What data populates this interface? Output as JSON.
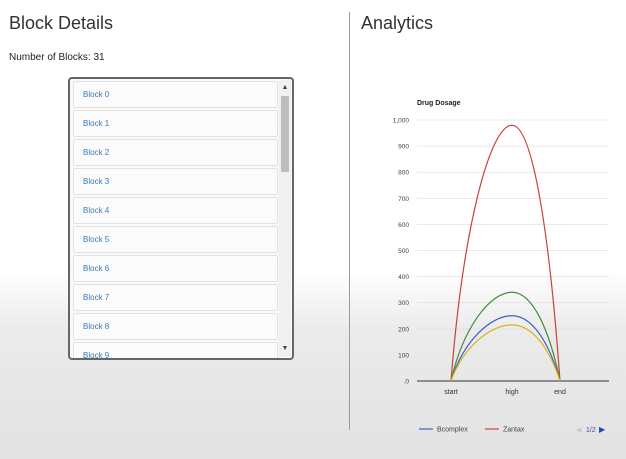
{
  "left": {
    "title": "Block Details",
    "count_label": "Number of Blocks: 31",
    "blocks": [
      "Block 0",
      "Block 1",
      "Block 2",
      "Block 3",
      "Block 4",
      "Block 5",
      "Block 6",
      "Block 7",
      "Block 8",
      "Block 9"
    ]
  },
  "right": {
    "title": "Analytics",
    "pager": "1/2"
  },
  "icons": {
    "scroll_up": "triangle-up-icon",
    "scroll_down": "triangle-down-icon",
    "prev": "triangle-left-icon",
    "next": "triangle-right-icon"
  },
  "chart_data": {
    "type": "line",
    "title": "Drug Dosage",
    "categories": [
      "start",
      "high",
      "end"
    ],
    "ylim": [
      0,
      1000
    ],
    "yticks": [
      0,
      100,
      200,
      300,
      400,
      500,
      600,
      700,
      800,
      900,
      1000
    ],
    "ytick_labels": [
      ".0",
      "100",
      "200",
      "300",
      "400",
      "500",
      "600",
      "700",
      "800",
      "900",
      "1,000"
    ],
    "grid": true,
    "smooth": true,
    "legend_position": "bottom",
    "series": [
      {
        "name": "Bcomplex",
        "values": [
          0,
          250,
          0
        ],
        "color": "#3f5fbf"
      },
      {
        "name": "Zantax",
        "values": [
          0,
          980,
          0
        ],
        "color": "#c8423a"
      },
      {
        "name": "",
        "values": [
          0,
          340,
          0
        ],
        "color": "#3e8e3e"
      },
      {
        "name": "",
        "values": [
          0,
          215,
          0
        ],
        "color": "#e0b020"
      }
    ]
  }
}
